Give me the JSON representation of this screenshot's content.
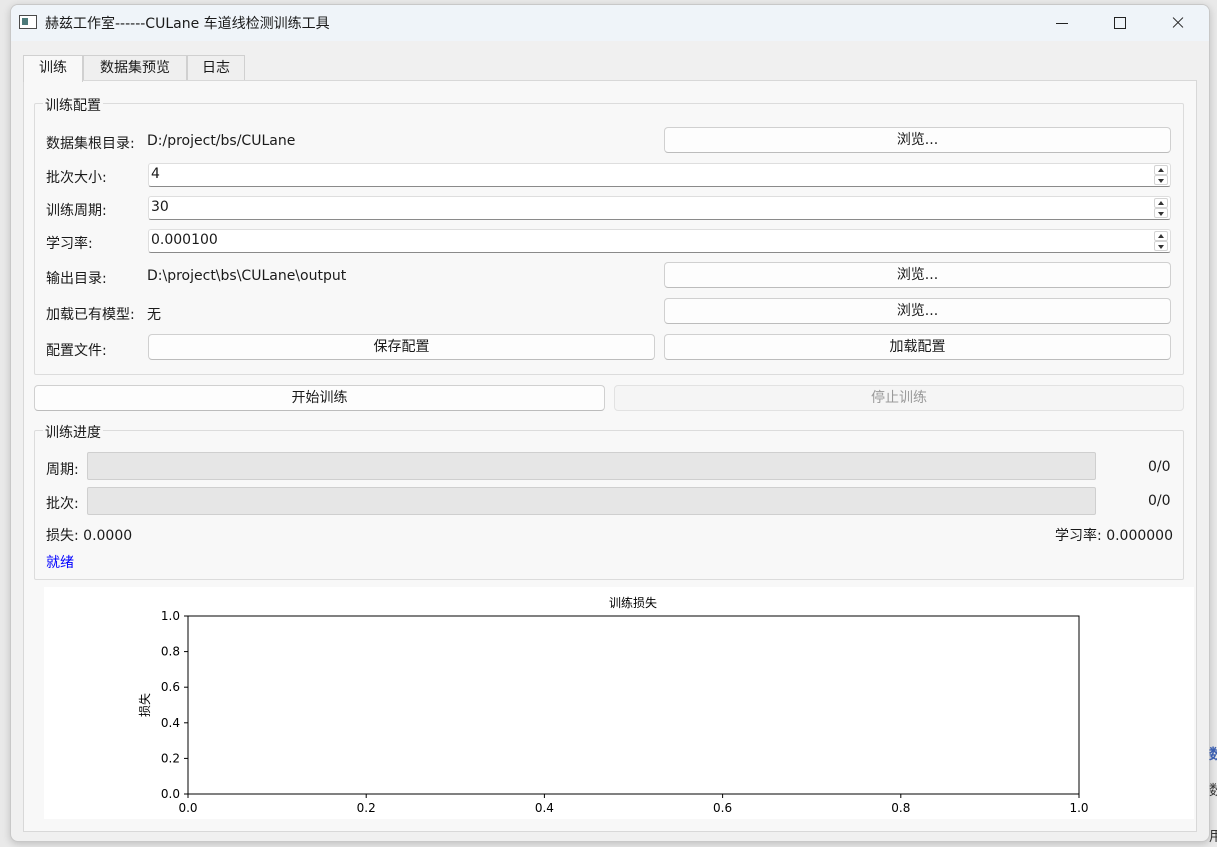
{
  "window": {
    "title": "赫兹工作室------CULane 车道线检测训练工具"
  },
  "tabs": [
    "训练",
    "数据集预览",
    "日志"
  ],
  "config": {
    "group_title": "训练配置",
    "dataset_label": "数据集根目录:",
    "dataset_value": "D:/project/bs/CULane",
    "browse_label": "浏览...",
    "batch_label": "批次大小:",
    "batch_value": "4",
    "epochs_label": "训练周期:",
    "epochs_value": "30",
    "lr_label": "学习率:",
    "lr_value": "0.000100",
    "output_label": "输出目录:",
    "output_value": "D:\\project\\bs\\CULane\\output",
    "model_label": "加载已有模型:",
    "model_value": "无",
    "cfgfile_label": "配置文件:",
    "save_cfg_label": "保存配置",
    "load_cfg_label": "加载配置"
  },
  "actions": {
    "start_label": "开始训练",
    "stop_label": "停止训练"
  },
  "progress": {
    "group_title": "训练进度",
    "epoch_label": "周期:",
    "epoch_value": "0/0",
    "epoch_fraction": 0,
    "batch_label": "批次:",
    "batch_value": "0/0",
    "batch_fraction": 0,
    "loss_label": "损失:",
    "loss_value": "0.0000",
    "lr_label": "学习率:",
    "lr_value": "0.000000",
    "status_text": "就绪",
    "status_color": "#0000ff",
    "progress_color": "#06b025"
  },
  "chart_data": {
    "type": "line",
    "title": "训练损失",
    "xlabel": "",
    "ylabel": "损失",
    "xlim": [
      0.0,
      1.0
    ],
    "ylim": [
      0.0,
      1.0
    ],
    "xticks": [
      "0.0",
      "0.2",
      "0.4",
      "0.6",
      "0.8",
      "1.0"
    ],
    "yticks": [
      "0.0",
      "0.2",
      "0.4",
      "0.6",
      "0.8",
      "1.0"
    ],
    "grid": false,
    "series": []
  },
  "edge_fragments": {
    "frag1": "数",
    "frag2": "用"
  }
}
